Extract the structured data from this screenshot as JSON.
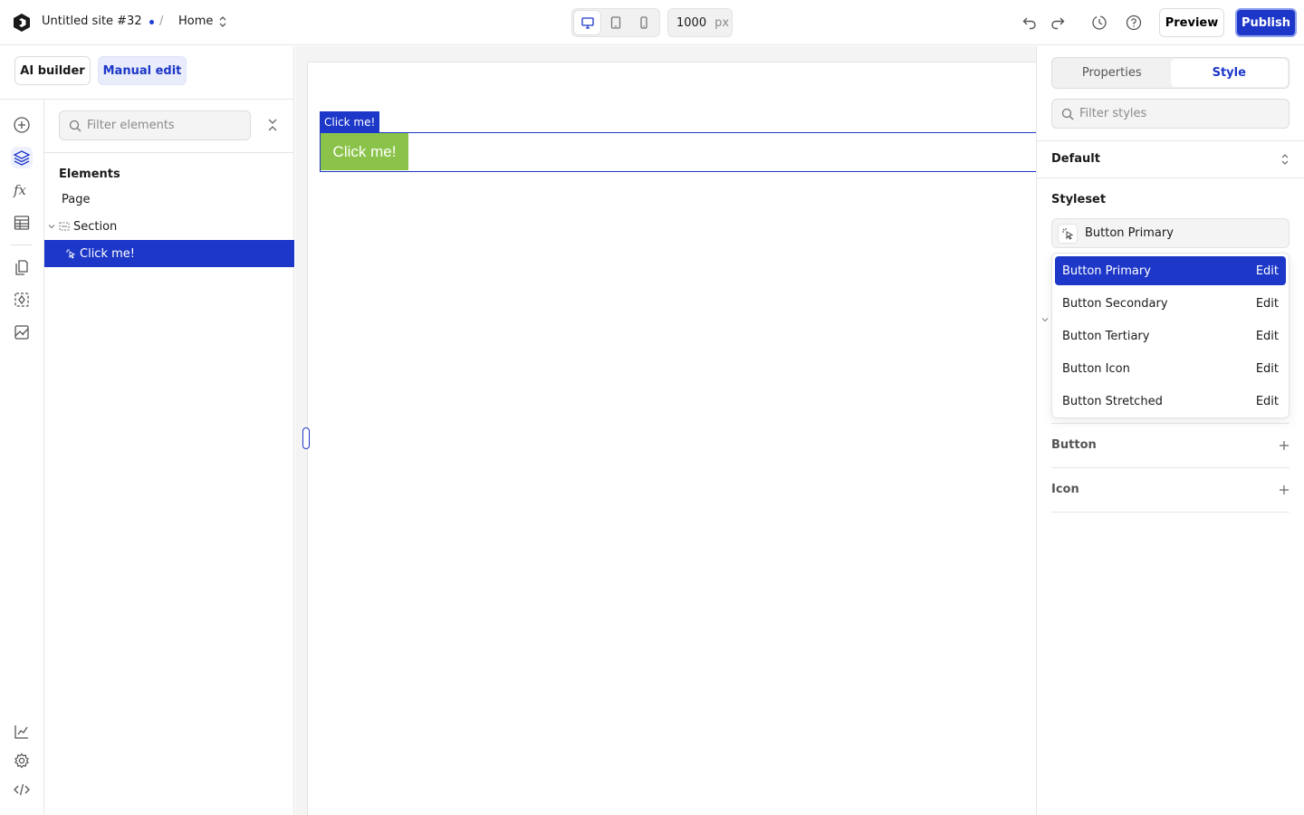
{
  "header": {
    "site_name": "Untitled site #32",
    "separator": "/",
    "page_name": "Home",
    "canvas_width": "1000",
    "width_unit": "px",
    "preview_label": "Preview",
    "publish_label": "Publish",
    "icons": [
      "logo-icon",
      "desktop-icon",
      "tablet-icon",
      "mobile-icon",
      "undo-icon",
      "redo-icon",
      "history-icon",
      "help-icon"
    ]
  },
  "mode": {
    "ai_label": "AI builder",
    "manual_label": "Manual edit",
    "active": "Manual edit"
  },
  "rail": {
    "icons": [
      "add-icon",
      "layers-icon",
      "formula-icon",
      "table-icon",
      "pages-icon",
      "components-icon",
      "assets-icon",
      "analytics-icon",
      "settings-icon",
      "code-icon"
    ],
    "active": "layers-icon"
  },
  "elements_panel": {
    "filter_placeholder": "Filter elements",
    "title": "Elements",
    "tree": [
      {
        "label": "Page",
        "selected": false
      },
      {
        "label": "Section",
        "selected": false
      },
      {
        "label": "Click me!",
        "selected": true
      }
    ]
  },
  "canvas": {
    "selection_label": "Click me!",
    "button_text": "Click me!",
    "button_color": "#8bc34a"
  },
  "style_panel": {
    "tabs": [
      {
        "label": "Properties",
        "active": false
      },
      {
        "label": "Style",
        "active": true
      }
    ],
    "filter_placeholder": "Filter styles",
    "state": "Default",
    "styleset_title": "Styleset",
    "styleset_value": "Button Primary",
    "dropdown": [
      {
        "label": "Button Primary",
        "action": "Edit",
        "selected": true
      },
      {
        "label": "Button Secondary",
        "action": "Edit",
        "selected": false
      },
      {
        "label": "Button Tertiary",
        "action": "Edit",
        "selected": false
      },
      {
        "label": "Button Icon",
        "action": "Edit",
        "selected": false
      },
      {
        "label": "Button Stretched",
        "action": "Edit",
        "selected": false
      }
    ],
    "sections": [
      {
        "label": "Button"
      },
      {
        "label": "Icon"
      }
    ]
  },
  "colors": {
    "accent": "#1d37c8",
    "accent_light": "#e9ecfb"
  }
}
